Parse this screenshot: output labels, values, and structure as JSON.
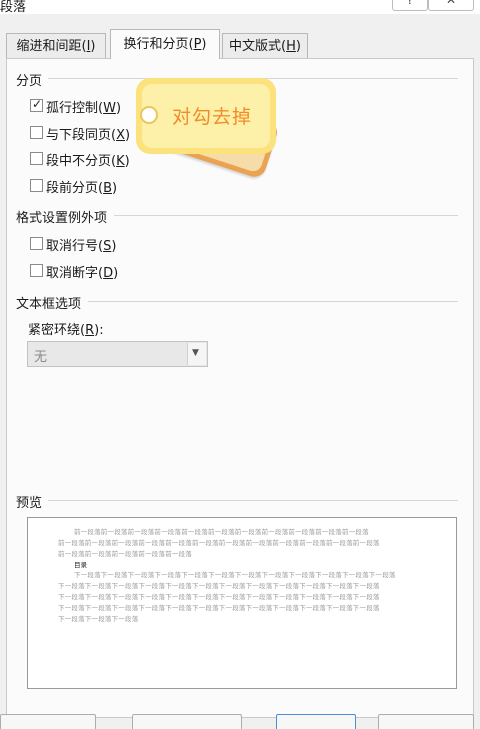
{
  "window": {
    "title": "段落",
    "help_label": "?",
    "close_label": "✕"
  },
  "tabs": [
    {
      "label": "缩进和间距(",
      "key": "I",
      "suffix": ")",
      "active": false
    },
    {
      "label": "换行和分页(",
      "key": "P",
      "suffix": ")",
      "active": true
    },
    {
      "label": "中文版式(",
      "key": "H",
      "suffix": ")",
      "active": false
    }
  ],
  "pagination": {
    "heading": "分页",
    "options": [
      {
        "label": "孤行控制(",
        "key": "W",
        "suffix": ")",
        "checked": true
      },
      {
        "label": "与下段同页(",
        "key": "X",
        "suffix": ")",
        "checked": false
      },
      {
        "label": "段中不分页(",
        "key": "K",
        "suffix": ")",
        "checked": false
      },
      {
        "label": "段前分页(",
        "key": "B",
        "suffix": ")",
        "checked": false
      }
    ]
  },
  "exceptions": {
    "heading": "格式设置例外项",
    "options": [
      {
        "label": "取消行号(",
        "key": "S",
        "suffix": ")",
        "checked": false
      },
      {
        "label": "取消断字(",
        "key": "D",
        "suffix": ")",
        "checked": false
      }
    ]
  },
  "textbox": {
    "heading": "文本框选项",
    "wrap_label": "紧密环绕(",
    "wrap_key": "R",
    "wrap_suffix": "):",
    "select_value": "无"
  },
  "preview": {
    "heading": "预览",
    "prev_lines": [
      "前一段落前一段落前一段落前一段落前一段落前一段落前一段落前一段落前一段落前一段落前一段落",
      "前一段落前一段落前一段落前一段落前一段落前一段落前一段落前一段落前一段落前一段落前一段落前一段落",
      "前一段落前一段落前一段落前一段落前一段落"
    ],
    "current_text": "目录",
    "next_lines": [
      "下一段落下一段落下一段落下一段落下一段落下一段落下一段落下一段落下一段落下一段落下一段落下一段落",
      "下一段落下一段落下一段落下一段落下一段落下一段落下一段落下一段落下一段落下一段落下一段落下一段落",
      "下一段落下一段落下一段落下一段落下一段落下一段落下一段落下一段落下一段落下一段落下一段落下一段落",
      "下一段落下一段落下一段落下一段落下一段落下一段落下一段落下一段落下一段落下一段落下一段落下一段落",
      "下一段落下一段落下一段落"
    ]
  },
  "annotation": {
    "text": "对勾去掉"
  }
}
